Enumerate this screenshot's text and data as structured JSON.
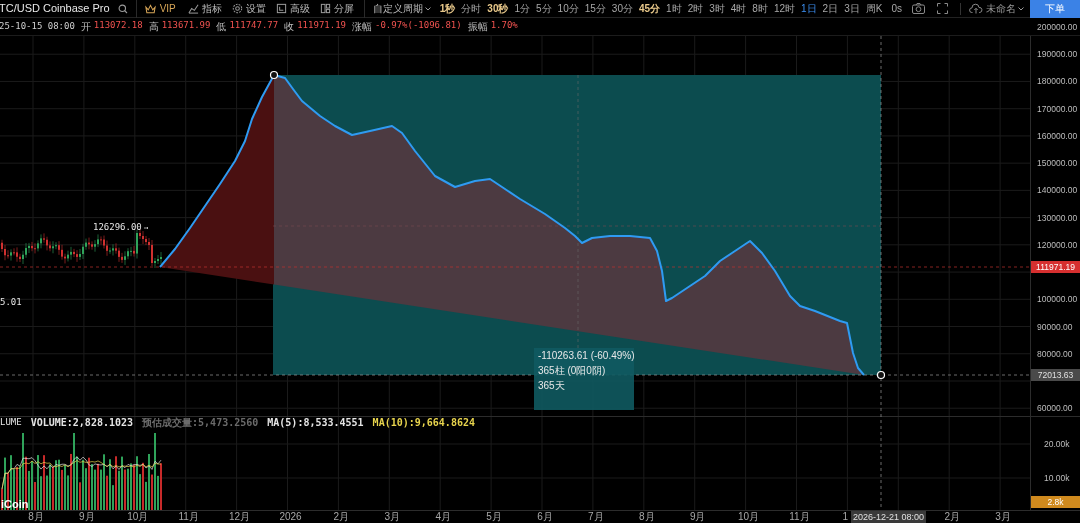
{
  "toolbar": {
    "symbol": "TC/USD Coinbase Pro",
    "vip": "VIP",
    "tools": [
      "指标",
      "设置",
      "高级",
      "分屏"
    ],
    "custom_period": "自定义周期",
    "periods": [
      {
        "label": "1秒",
        "favorite": true,
        "selected": false
      },
      {
        "label": "分时",
        "favorite": false,
        "selected": false
      },
      {
        "label": "30秒",
        "favorite": true,
        "selected": false
      },
      {
        "label": "1分",
        "favorite": false,
        "selected": false
      },
      {
        "label": "5分",
        "favorite": false,
        "selected": false
      },
      {
        "label": "10分",
        "favorite": false,
        "selected": false
      },
      {
        "label": "15分",
        "favorite": false,
        "selected": false
      },
      {
        "label": "30分",
        "favorite": false,
        "selected": false
      },
      {
        "label": "45分",
        "favorite": true,
        "selected": false
      },
      {
        "label": "1时",
        "favorite": false,
        "selected": false
      },
      {
        "label": "2时",
        "favorite": false,
        "selected": false
      },
      {
        "label": "3时",
        "favorite": false,
        "selected": false
      },
      {
        "label": "4时",
        "favorite": false,
        "selected": false
      },
      {
        "label": "8时",
        "favorite": false,
        "selected": false
      },
      {
        "label": "12时",
        "favorite": false,
        "selected": false
      },
      {
        "label": "1日",
        "favorite": false,
        "selected": true
      },
      {
        "label": "2日",
        "favorite": false,
        "selected": false
      },
      {
        "label": "3日",
        "favorite": false,
        "selected": false
      },
      {
        "label": "周K",
        "favorite": false,
        "selected": false
      }
    ],
    "timer": "0s",
    "layout_name": "未命名",
    "order_button": "下单"
  },
  "ohlc": {
    "date": "25-10-15 08:00",
    "fields": [
      {
        "label": "开",
        "value": "113072.18"
      },
      {
        "label": "高",
        "value": "113671.99"
      },
      {
        "label": "低",
        "value": "111747.77"
      },
      {
        "label": "收",
        "value": "111971.19"
      },
      {
        "label": "涨幅",
        "value": "-0.97%(-1096.81)"
      },
      {
        "label": "振幅",
        "value": "1.70%"
      }
    ]
  },
  "chart": {
    "high_label": "126296.00",
    "left_label": "5.01",
    "measure": {
      "change": "-110263.61 (-60.49%)",
      "bars": "365柱 (0阳0阴)",
      "days": "365天"
    },
    "price_axis": [
      "200000.00",
      "190000.00",
      "180000.00",
      "170000.00",
      "160000.00",
      "150000.00",
      "140000.00",
      "130000.00",
      "120000.00",
      "100000.00",
      "90000.00",
      "80000.00",
      "60000.00"
    ],
    "last_price": "111971.19",
    "cursor_price": "72013.63",
    "cursor_time": "2026-12-21 08:00"
  },
  "volume": {
    "title": "LUME",
    "fields": [
      {
        "text": "VOLUME:2,828.1023",
        "color": "#e5e5e5"
      },
      {
        "text": "预估成交量:5,473.2560",
        "color": "#6b6b6b"
      },
      {
        "text": "MA(5):8,533.4551",
        "color": "#e5e5e5"
      },
      {
        "text": "MA(10):9,664.8624",
        "color": "#e8d44d"
      }
    ],
    "axis": [
      "20.00k",
      "10.00k"
    ],
    "last_volume": "2.8k",
    "logo": "iCoin"
  },
  "time_axis": [
    "8月",
    "9月",
    "10月",
    "11月",
    "12月",
    "2026",
    "2月",
    "3月",
    "4月",
    "5月",
    "6月",
    "7月",
    "8月",
    "9月",
    "10月",
    "11月",
    "1",
    "2月",
    "3月"
  ]
}
